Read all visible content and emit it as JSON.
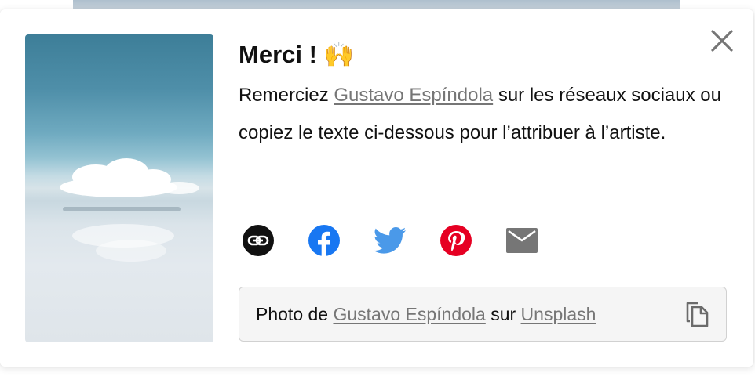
{
  "dialog": {
    "title": "Merci !",
    "title_emoji": "🙌",
    "message": {
      "prefix": "Remerciez ",
      "author_link": "Gustavo Espíndola",
      "suffix": " sur les réseaux sociaux ou copiez le texte ci-dessous pour l’attribuer à l’artiste."
    },
    "share_buttons": [
      {
        "name": "link",
        "icon": "link-icon",
        "color": "#111111"
      },
      {
        "name": "facebook",
        "icon": "facebook-icon",
        "color": "#1877f2"
      },
      {
        "name": "twitter",
        "icon": "twitter-icon",
        "color": "#4a99e9"
      },
      {
        "name": "pinterest",
        "icon": "pinterest-icon",
        "color": "#e60023"
      },
      {
        "name": "email",
        "icon": "email-icon",
        "color": "#767676"
      }
    ],
    "attribution": {
      "prefix": "Photo de ",
      "author_link": "Gustavo Espíndola",
      "middle": " sur ",
      "site_link": "Unsplash",
      "copy_icon": "copy-icon"
    },
    "close_icon": "close-icon"
  }
}
